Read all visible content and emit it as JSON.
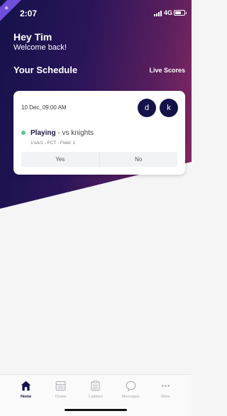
{
  "status_bar": {
    "ribbon": "α",
    "time": "2:07",
    "network": "4G",
    "battery_fraction": 0.7
  },
  "greeting": {
    "hello": "Hey Tim",
    "subtitle": "Welcome back!"
  },
  "schedule": {
    "title": "Your Schedule",
    "live_scores_label": "Live Scores"
  },
  "match_card": {
    "date": "10 Dec, 09:00 AM",
    "avatars": [
      "d",
      "k"
    ],
    "status": "Playing",
    "opponent": " - vs knights",
    "details": "1'sA/1 - FCT - Field: 1",
    "yes_label": "Yes",
    "no_label": "No",
    "status_color": "#58c98a"
  },
  "tabs": [
    {
      "label": "Home",
      "icon": "home-icon",
      "active": true
    },
    {
      "label": "Draws",
      "icon": "draws-icon",
      "active": false
    },
    {
      "label": "Ladders",
      "icon": "ladders-icon",
      "active": false
    },
    {
      "label": "Messages",
      "icon": "messages-icon",
      "active": false
    },
    {
      "label": "More",
      "icon": "more-icon",
      "active": false
    }
  ],
  "colors": {
    "primary": "#15124a",
    "accent": "#8a2a63",
    "ribbon": "#6f4fdc"
  }
}
